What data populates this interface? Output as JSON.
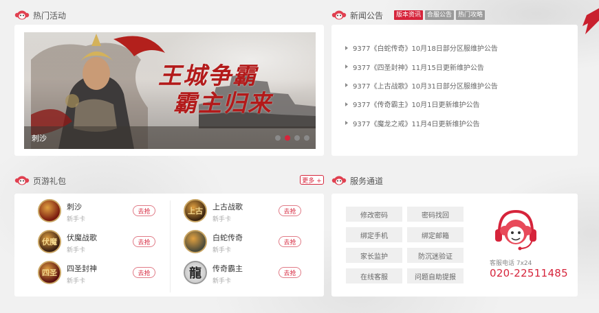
{
  "activities": {
    "title": "热门活动",
    "banner": {
      "headline_1": "王城争霸",
      "headline_2": "霸主归来",
      "caption": "刺沙",
      "slide_count": 4,
      "active_slide": 2
    }
  },
  "news": {
    "title": "新闻公告",
    "tags": [
      "版本资讯",
      "合服公告",
      "热门攻略"
    ],
    "active_tag": 0,
    "items": [
      "9377《白蛇传奇》10月18日部分区服维护公告",
      "9377《四圣封神》11月15日更新维护公告",
      "9377《上古战歌》10月31日部分区服维护公告",
      "9377《传奇霸主》10月1日更新维护公告",
      "9377《魔龙之戒》11月4日更新维护公告"
    ]
  },
  "gifts": {
    "title": "页游礼包",
    "more_label": "更多 +",
    "grab_label": "去抢",
    "left": [
      {
        "name": "刺沙",
        "type": "新手卡",
        "logo_text": "",
        "logo_color": "#7a1a0e"
      },
      {
        "name": "伏魔战歌",
        "type": "新手卡",
        "logo_text": "伏魔",
        "logo_color": "#3a1f12"
      },
      {
        "name": "四圣封神",
        "type": "新手卡",
        "logo_text": "四圣",
        "logo_color": "#5a1010"
      }
    ],
    "right": [
      {
        "name": "上古战歌",
        "type": "新手卡",
        "logo_text": "上古",
        "logo_color": "#3b2410"
      },
      {
        "name": "白蛇传奇",
        "type": "新手卡",
        "logo_text": "",
        "logo_color": "#4a4a3a"
      },
      {
        "name": "传奇霸主",
        "type": "新手卡",
        "logo_text": "龍",
        "logo_color": "#dcdcdc"
      }
    ]
  },
  "service": {
    "title": "服务通道",
    "buttons": [
      "修改密码",
      "密码找回",
      "绑定手机",
      "绑定邮箱",
      "家长监护",
      "防沉迷验证",
      "在线客服",
      "问题自助提报"
    ],
    "hotline_label": "客服电话 7x24",
    "hotline": "020-22511485"
  },
  "colors": {
    "accent": "#d6243b",
    "tag_inactive": "#9a9a9a",
    "page_bg": "#f1f1f1"
  }
}
